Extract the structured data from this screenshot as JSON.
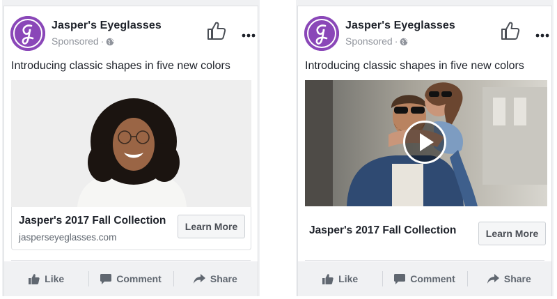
{
  "ads": [
    {
      "page_name": "Jasper's Eyeglasses",
      "sponsored": "Sponsored",
      "caption": "Introducing classic shapes in five new colors",
      "link_title": "Jasper's 2017 Fall Collection",
      "link_domain": "jasperseyeglasses.com",
      "cta": "Learn More",
      "media_type": "image"
    },
    {
      "page_name": "Jasper's Eyeglasses",
      "sponsored": "Sponsored",
      "caption": "Introducing classic shapes in five new colors",
      "link_title": "Jasper's 2017 Fall Collection",
      "cta": "Learn More",
      "media_type": "video"
    }
  ],
  "actions": {
    "like": "Like",
    "comment": "Comment",
    "share": "Share"
  },
  "colors": {
    "brand_purple": "#8a47b8",
    "text_primary": "#1d2129",
    "text_secondary": "#90949c"
  },
  "icons": [
    "logo-g-icon",
    "globe-icon",
    "thumbs-up-icon",
    "more-dots-icon",
    "play-icon",
    "like-icon",
    "comment-icon",
    "share-icon"
  ]
}
